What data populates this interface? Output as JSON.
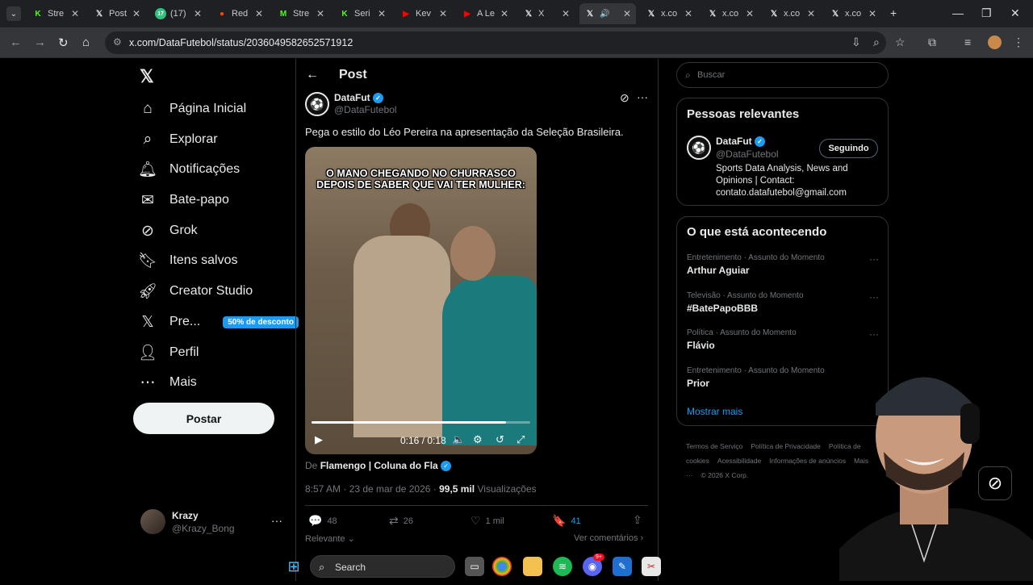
{
  "browser": {
    "tabs": [
      {
        "label": "Stre",
        "icon": "kick-icon",
        "color": "#53fc18"
      },
      {
        "label": "Post",
        "icon": "x-icon",
        "color": "#e7e9ea"
      },
      {
        "label": "(17)",
        "icon": "seventeen-icon",
        "color": "#2ec27e"
      },
      {
        "label": "Red",
        "icon": "reddit-icon",
        "color": "#ff4500"
      },
      {
        "label": "Stre",
        "icon": "m-icon",
        "color": "#53fc18"
      },
      {
        "label": "Seri",
        "icon": "kick-icon",
        "color": "#53fc18"
      },
      {
        "label": "Kev",
        "icon": "youtube-icon",
        "color": "#ff0000"
      },
      {
        "label": "A Le",
        "icon": "youtube-icon",
        "color": "#ff0000"
      },
      {
        "label": "X",
        "icon": "x-icon",
        "color": "#e7e9ea"
      },
      {
        "label": "",
        "icon": "x-icon",
        "color": "#e7e9ea"
      },
      {
        "label": "x.co",
        "icon": "x-icon",
        "color": "#e7e9ea"
      },
      {
        "label": "x.co",
        "icon": "x-icon",
        "color": "#e7e9ea"
      },
      {
        "label": "x.co",
        "icon": "x-icon",
        "color": "#e7e9ea"
      },
      {
        "label": "x.co",
        "icon": "x-icon",
        "color": "#e7e9ea"
      }
    ],
    "url": "x.com/DataFutebol/status/2036049582652571912"
  },
  "nav": {
    "items": [
      {
        "label": "Página Inicial",
        "icon": "home-icon"
      },
      {
        "label": "Explorar",
        "icon": "search-icon"
      },
      {
        "label": "Notificações",
        "icon": "bell-icon"
      },
      {
        "label": "Bate-papo",
        "icon": "mail-icon"
      },
      {
        "label": "Grok",
        "icon": "grok-icon"
      },
      {
        "label": "Itens salvos",
        "icon": "bookmark-icon"
      },
      {
        "label": "Creator Studio",
        "icon": "rocket-icon"
      },
      {
        "label": "Pre...",
        "icon": "x-icon"
      },
      {
        "label": "Perfil",
        "icon": "person-icon"
      },
      {
        "label": "Mais",
        "icon": "more-circle-icon"
      }
    ],
    "premium_badge": "50% de desconto",
    "post_button": "Postar",
    "account": {
      "name": "Krazy",
      "handle": "@Krazy_Bong"
    }
  },
  "post": {
    "header": "Post",
    "author": {
      "name": "DataFut",
      "handle": "@DataFutebol"
    },
    "text": "Pega o estilo do Léo Pereira na apresentação da Seleção Brasileira.",
    "video": {
      "caption_line1": "O MANO CHEGANDO NO CHURRASCO",
      "caption_line2": "DEPOIS DE SABER QUE VAI TER MULHER:",
      "time": "0:16 / 0:18",
      "progress": 0.89
    },
    "source_prefix": "De",
    "source": "Flamengo | Coluna do Fla",
    "timestamp": "8:57 AM · 23 de mar de 2026 ·",
    "views_count": "99,5 mil",
    "views_label": "Visualizações",
    "stats": {
      "replies": "48",
      "reposts": "26",
      "likes": "1 mil",
      "bookmarks": "41"
    },
    "sort_label": "Relevante",
    "comments_link": "Ver comentários"
  },
  "sidebar": {
    "search_placeholder": "Buscar",
    "relevant": {
      "title": "Pessoas relevantes",
      "name": "DataFut",
      "handle": "@DataFutebol",
      "follow_label": "Seguindo",
      "bio": "Sports Data Analysis, News and Opinions | Contact: contato.datafutebol@gmail.com"
    },
    "trending": {
      "title": "O que está acontecendo",
      "items": [
        {
          "category": "Entretenimento · Assunto do Momento",
          "name": "Arthur Aguiar"
        },
        {
          "category": "Televisão · Assunto do Momento",
          "name": "#BatePapoBBB"
        },
        {
          "category": "Política · Assunto do Momento",
          "name": "Flávio"
        },
        {
          "category": "Entretenimento · Assunto do Momento",
          "name": "Prior"
        }
      ],
      "show_more": "Mostrar mais"
    },
    "footer": [
      "Termos de Serviço",
      "Política de Privacidade",
      "Política de cookies",
      "Acessibilidade",
      "Informações de anúncios",
      "Mais ···",
      "© 2026 X Corp."
    ]
  },
  "taskbar": {
    "search_label": "Search",
    "discord_badge": "9+"
  }
}
